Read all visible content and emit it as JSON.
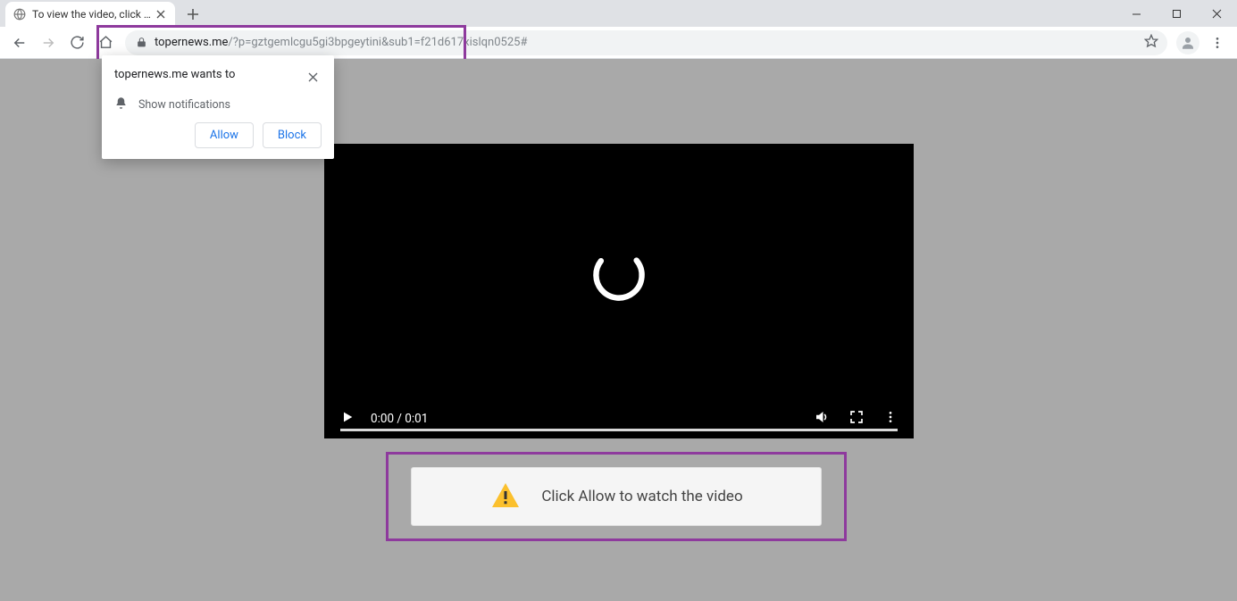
{
  "tab": {
    "title": "To view the video, click the Allow"
  },
  "url": {
    "host": "topernews.me",
    "path": "/?p=gztgemlcgu5gi3bpgeytini&sub1=f21d617xislqn0525#"
  },
  "notification": {
    "header": "topernews.me wants to",
    "permission": "Show notifications",
    "allow": "Allow",
    "block": "Block"
  },
  "video": {
    "time": "0:00 / 0:01"
  },
  "instruction": {
    "message": "Click Allow to watch the video"
  }
}
